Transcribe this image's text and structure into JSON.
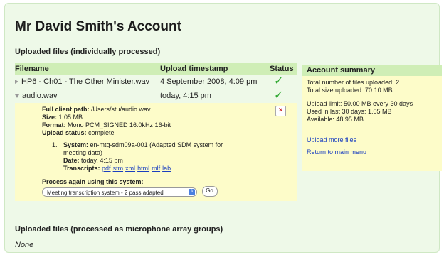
{
  "page": {
    "title": "Mr David Smith's Account",
    "uploaded_individually_heading": "Uploaded files (individually processed)",
    "uploaded_groups_heading": "Uploaded files (processed as microphone array groups)",
    "groups_value": "None"
  },
  "table": {
    "columns": [
      "Filename",
      "Upload timestamp",
      "Status"
    ],
    "rows": [
      {
        "filename": "HP6 - Ch01 - The Other Minister.wav",
        "timestamp": "4 September 2008, 4:09 pm",
        "status_icon": "checkmark-icon",
        "expanded": false
      },
      {
        "filename": "audio.wav",
        "timestamp": "today, 4:15 pm",
        "status_icon": "checkmark-icon",
        "expanded": true
      }
    ],
    "status_glyph": "✓"
  },
  "detail": {
    "full_client_path_label": "Full client path:",
    "full_client_path": "/Users/stu/audio.wav",
    "size_label": "Size:",
    "size": "1.05 MB",
    "format_label": "Format:",
    "format": "Mono PCM_SIGNED 16.0kHz 16-bit",
    "upload_status_label": "Upload status:",
    "upload_status": "complete",
    "close_glyph": "×",
    "systems": [
      {
        "number": "1.",
        "system_label": "System:",
        "system": "en-mtg-sdm09a-001 (Adapted SDM system for meeting data)",
        "date_label": "Date:",
        "date": "today, 4:15 pm",
        "transcripts_label": "Transcripts:",
        "transcripts": [
          "pdf",
          "stm",
          "xml",
          "html",
          "mlf",
          "lab"
        ]
      }
    ],
    "process_again_label": "Process again using this system:",
    "process_select_value": "Meeting transcription system - 2 pass adapted",
    "go_label": "Go"
  },
  "summary": {
    "heading": "Account summary",
    "total_files": "Total number of files uploaded: 2",
    "total_size": "Total size uploaded: 70.10 MB",
    "upload_limit": "Upload limit: 50.00 MB every 30 days",
    "used_last_30": "Used in last 30 days: 1.05 MB",
    "available": "Available: 48.95 MB",
    "upload_more_link": "Upload more files",
    "return_main_link": "Return to main menu"
  },
  "colors": {
    "panel_bg": "#eef9e8",
    "header_bg": "#cfeeb6",
    "detail_bg": "#fdfcc9",
    "check": "#2fa830",
    "link": "#1a3fc0"
  }
}
